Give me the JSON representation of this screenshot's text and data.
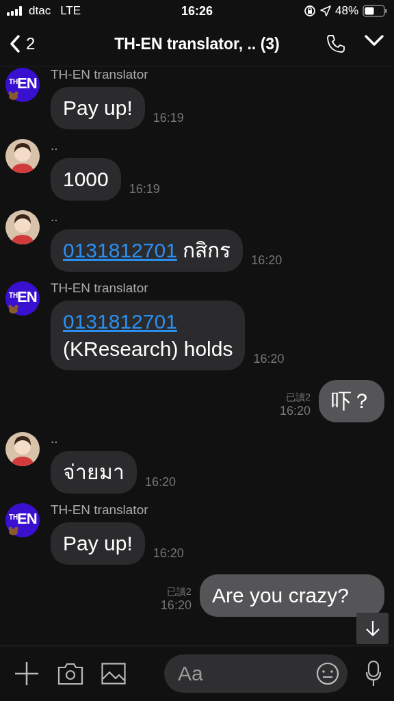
{
  "status_bar": {
    "carrier": "dtac",
    "network": "LTE",
    "time": "16:26",
    "battery_text": "48%"
  },
  "header": {
    "back_count": "2",
    "title": "TH-EN translator, .. (3)"
  },
  "messages": [
    {
      "kind": "in",
      "sender": "TH-EN translator",
      "avatar": {
        "kind": "logo",
        "top": "TH",
        "main": "EN"
      },
      "lines": [
        [
          {
            "text": "Pay up!",
            "link": false
          }
        ]
      ],
      "time": "16:19"
    },
    {
      "kind": "in",
      "sender": "..",
      "avatar": {
        "kind": "person"
      },
      "lines": [
        [
          {
            "text": "1000",
            "link": false
          }
        ]
      ],
      "time": "16:19"
    },
    {
      "kind": "in",
      "sender": "..",
      "avatar": {
        "kind": "person"
      },
      "lines": [
        [
          {
            "text": "0131812701",
            "link": true
          },
          {
            "text": " กสิกร",
            "link": false
          }
        ]
      ],
      "time": "16:20"
    },
    {
      "kind": "in",
      "sender": "TH-EN translator",
      "avatar": {
        "kind": "logo",
        "top": "TH",
        "main": "EN"
      },
      "lines": [
        [
          {
            "text": "0131812701",
            "link": true
          }
        ],
        [
          {
            "text": "(KResearch) holds",
            "link": false
          }
        ]
      ],
      "time": "16:20"
    },
    {
      "kind": "out",
      "read": "已讀2",
      "lines": [
        [
          {
            "text": "吓？",
            "link": false
          }
        ]
      ],
      "time": "16:20"
    },
    {
      "kind": "in",
      "sender": "..",
      "avatar": {
        "kind": "person"
      },
      "lines": [
        [
          {
            "text": "จ่ายมา",
            "link": false
          }
        ]
      ],
      "time": "16:20"
    },
    {
      "kind": "in",
      "sender": "TH-EN translator",
      "avatar": {
        "kind": "logo",
        "top": "TH",
        "main": "EN"
      },
      "lines": [
        [
          {
            "text": "Pay up!",
            "link": false
          }
        ]
      ],
      "time": "16:20"
    },
    {
      "kind": "out",
      "read": "已讀2",
      "lines": [
        [
          {
            "text": "Are you crazy?",
            "link": false
          }
        ]
      ],
      "time": "16:20"
    }
  ],
  "input": {
    "placeholder": "Aa"
  }
}
